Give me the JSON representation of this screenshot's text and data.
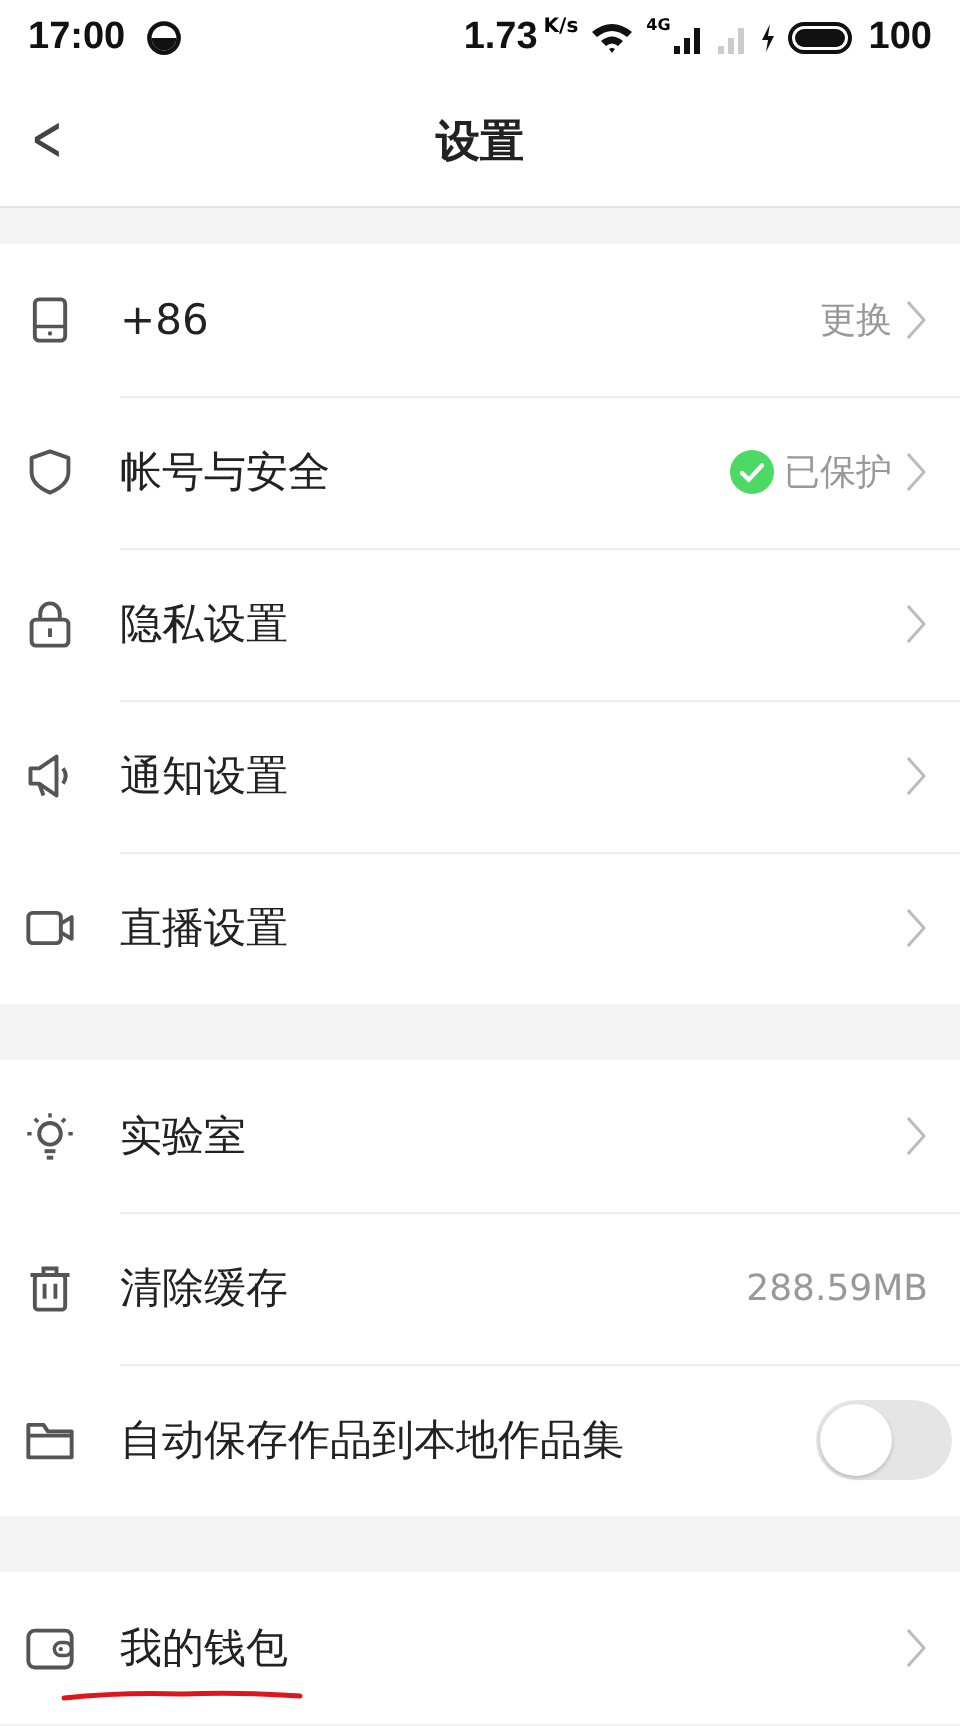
{
  "status_bar": {
    "time": "17:00",
    "speed": "1.73",
    "speed_unit": "K/s",
    "network": "4G",
    "battery": "100"
  },
  "header": {
    "back": "<",
    "title": "设置"
  },
  "groups": [
    {
      "items": [
        {
          "kind": "link",
          "label": "+86",
          "value": "更换"
        },
        {
          "kind": "verified",
          "label": "帐号与安全",
          "value": "已保护"
        },
        {
          "kind": "link",
          "label": "隐私设置"
        },
        {
          "kind": "link",
          "label": "通知设置"
        },
        {
          "kind": "link",
          "label": "直播设置"
        }
      ]
    },
    {
      "items": [
        {
          "kind": "link",
          "label": "实验室"
        },
        {
          "kind": "info",
          "label": "清除缓存",
          "value": "288.59MB"
        },
        {
          "kind": "switch",
          "label": "自动保存作品到本地作品集",
          "on": false
        }
      ]
    },
    {
      "items": [
        {
          "kind": "link",
          "label": "我的钱包",
          "underlined": true
        }
      ]
    }
  ]
}
